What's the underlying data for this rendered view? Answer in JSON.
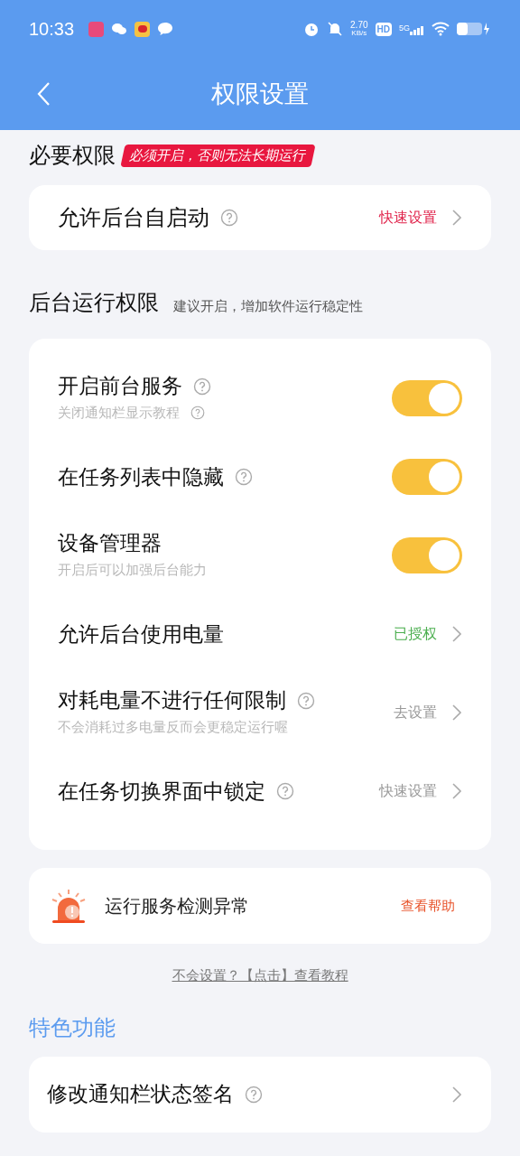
{
  "status_bar": {
    "time": "10:33",
    "speed": "2.70",
    "speed_unit": "KB/s",
    "hd": "HD",
    "network": "5G"
  },
  "header": {
    "title": "权限设置"
  },
  "required": {
    "title": "必要权限",
    "badge": "必须开启，否则无法长期运行",
    "items": [
      {
        "kind": "link",
        "title": "允许后台自启动",
        "help": true,
        "action": "快速设置",
        "color": "#e0224a"
      }
    ]
  },
  "background": {
    "title": "后台运行权限",
    "hint": "建议开启，增加软件运行稳定性",
    "items": [
      {
        "kind": "toggle",
        "title": "开启前台服务",
        "help": true,
        "subtitle": "关闭通知栏显示教程",
        "subtitle_help": true,
        "on": true
      },
      {
        "kind": "toggle",
        "title": "在任务列表中隐藏",
        "help": true,
        "on": true
      },
      {
        "kind": "toggle",
        "title": "设备管理器",
        "help": false,
        "subtitle": "开启后可以加强后台能力",
        "subtitle_help": false,
        "on": true
      },
      {
        "kind": "link",
        "title": "允许后台使用电量",
        "help": false,
        "action": "已授权",
        "color": "#4caf50"
      },
      {
        "kind": "link",
        "title": "对耗电量不进行任何限制",
        "help": true,
        "subtitle": "不会消耗过多电量反而会更稳定运行喔",
        "subtitle_help": false,
        "action": "去设置",
        "color": "#999999"
      },
      {
        "kind": "link",
        "title": "在任务切换界面中锁定",
        "help": true,
        "action": "快速设置",
        "color": "#999999"
      }
    ]
  },
  "alert": {
    "text": "运行服务检测异常",
    "action": "查看帮助"
  },
  "tutorial_link": "不会设置？【点击】查看教程",
  "features": {
    "title": "特色功能",
    "items": [
      {
        "kind": "link",
        "title": "修改通知栏状态签名",
        "help": true
      }
    ]
  }
}
